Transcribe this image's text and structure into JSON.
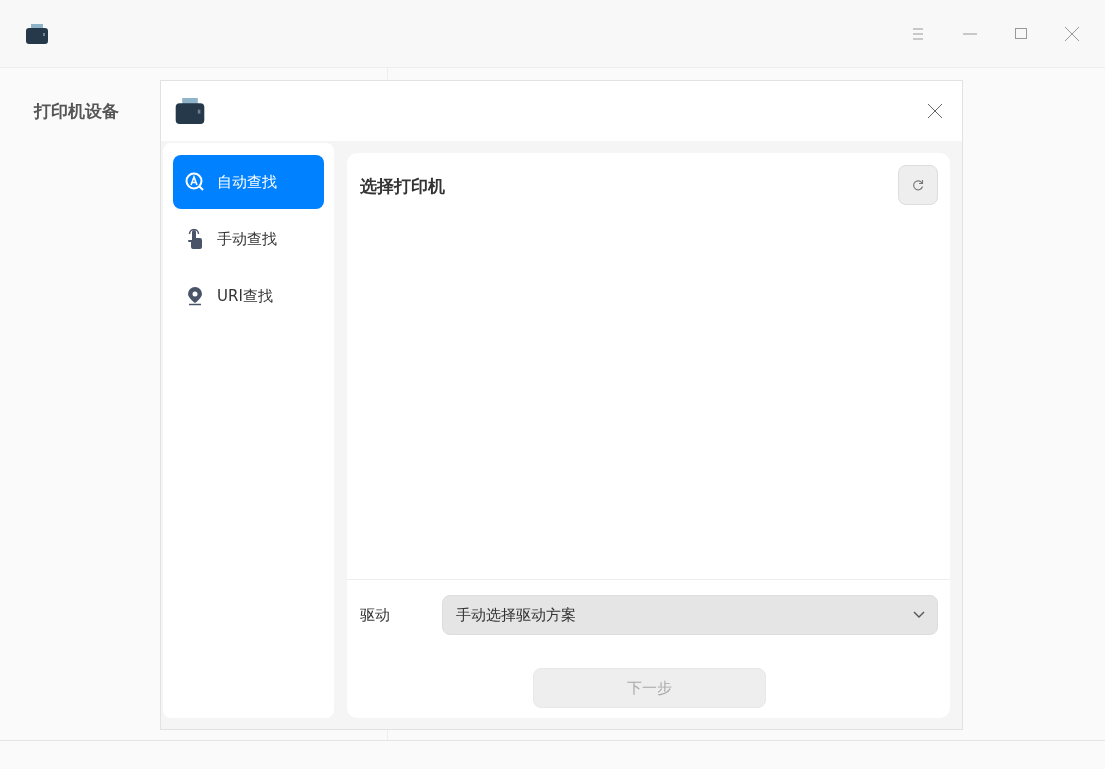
{
  "sidebar": {
    "heading": "打印机设备"
  },
  "dialog": {
    "nav": [
      {
        "kind": "auto",
        "label": "自动查找",
        "selected": true
      },
      {
        "kind": "manual",
        "label": "手动查找",
        "selected": false
      },
      {
        "kind": "uri",
        "label": "URI查找",
        "selected": false
      }
    ],
    "panel": {
      "title": "选择打印机"
    },
    "driver": {
      "label": "驱动",
      "value": "手动选择驱动方案"
    },
    "next_button": {
      "label": "下一步",
      "disabled": true
    }
  }
}
